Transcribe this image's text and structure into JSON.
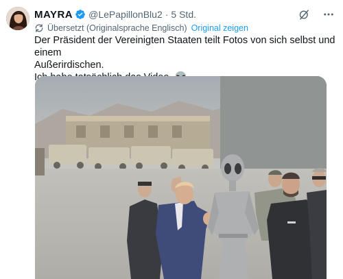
{
  "author": {
    "display_name": "MAYRA",
    "handle": "@LePapillonBlu2",
    "separator": "·",
    "time": "5 Std."
  },
  "translation": {
    "note": "Übersetzt (Originalsprache Englisch)",
    "show_original": "Original zeigen"
  },
  "tweet": {
    "line1": "Der Präsident der Vereinigten Staaten teilt Fotos von sich selbst und einem",
    "line2": "Außerirdischen.",
    "line3": "Ich habe tatsächlich das Video. 👽"
  },
  "icons": {
    "verified": "verified-badge-icon",
    "grok": "grok-icon",
    "more": "more-icon",
    "translate": "translate-icon"
  },
  "colors": {
    "accent": "#1d9bf0",
    "muted": "#536471"
  }
}
